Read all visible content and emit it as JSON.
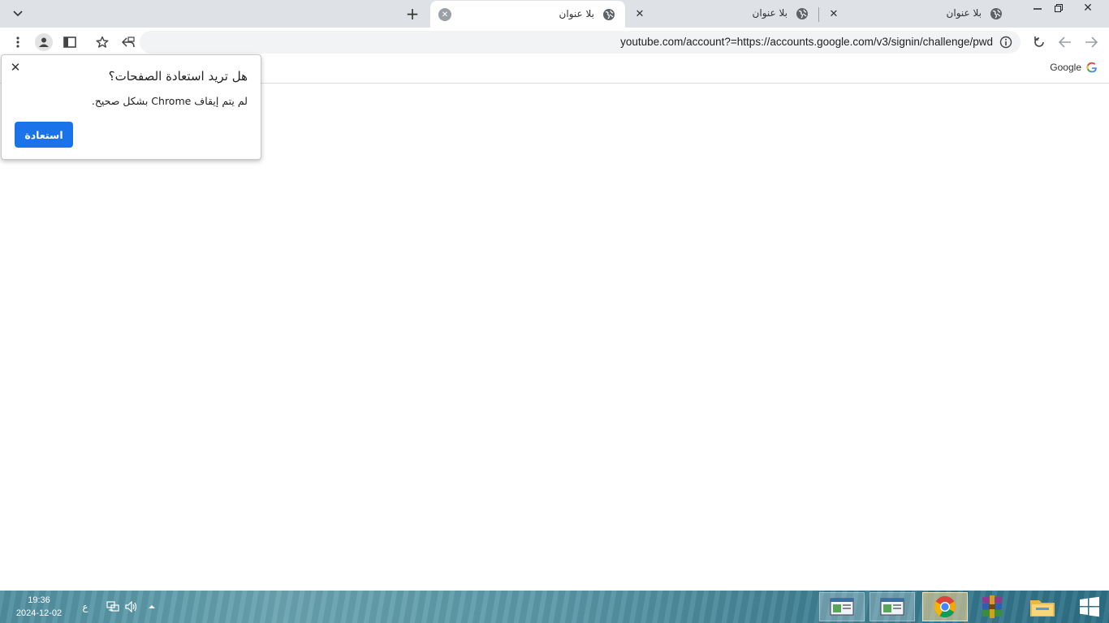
{
  "browser": {
    "tabs": [
      {
        "title": "بلا عنوان",
        "active": false
      },
      {
        "title": "بلا عنوان",
        "active": false
      },
      {
        "title": "بلا عنوان",
        "active": true
      }
    ],
    "url": "youtube.com/account?=https://accounts.google.com/v3/signin/challenge/pwd",
    "bookmarks": [
      {
        "label": "Google"
      }
    ]
  },
  "restore_popup": {
    "title": "هل تريد استعادة الصفحات؟",
    "message": "لم يتم إيقاف Chrome بشكل صحيح.",
    "button_label": "استعادة"
  },
  "taskbar": {
    "time": "19:36",
    "date": "2024-12-02",
    "input_language": "ع"
  },
  "colors": {
    "accent": "#1a73e8",
    "titlebar": "#dee1e6",
    "omnibox": "#f1f3f4"
  }
}
